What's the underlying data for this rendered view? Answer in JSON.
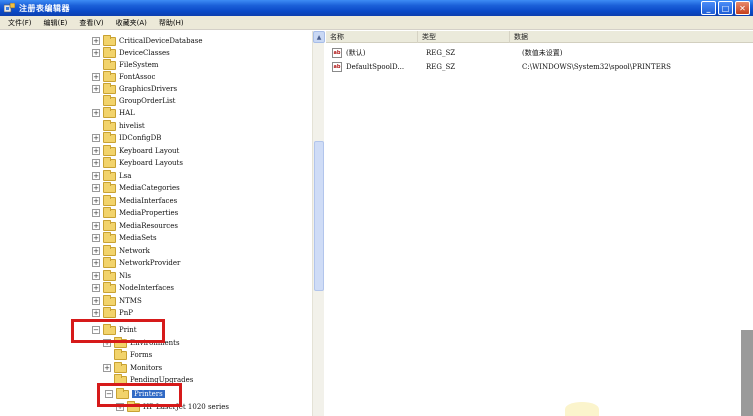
{
  "window": {
    "title": "注册表编辑器",
    "buttons": {
      "minimize": "_",
      "maximize": "□",
      "close": "✕"
    }
  },
  "menu": [
    "文件(F)",
    "编辑(E)",
    "查看(V)",
    "收藏夹(A)",
    "帮助(H)"
  ],
  "tree": {
    "items": [
      {
        "label": "CriticalDeviceDatabase",
        "expander": "+"
      },
      {
        "label": "DeviceClasses",
        "expander": "+"
      },
      {
        "label": "FileSystem",
        "expander": ""
      },
      {
        "label": "FontAssoc",
        "expander": "+"
      },
      {
        "label": "GraphicsDrivers",
        "expander": "+"
      },
      {
        "label": "GroupOrderList",
        "expander": ""
      },
      {
        "label": "HAL",
        "expander": "+"
      },
      {
        "label": "hivelist",
        "expander": ""
      },
      {
        "label": "IDConfigDB",
        "expander": "+"
      },
      {
        "label": "Keyboard Layout",
        "expander": "+"
      },
      {
        "label": "Keyboard Layouts",
        "expander": "+"
      },
      {
        "label": "Lsa",
        "expander": "+"
      },
      {
        "label": "MediaCategories",
        "expander": "+"
      },
      {
        "label": "MediaInterfaces",
        "expander": "+"
      },
      {
        "label": "MediaProperties",
        "expander": "+"
      },
      {
        "label": "MediaResources",
        "expander": "+"
      },
      {
        "label": "MediaSets",
        "expander": "+"
      },
      {
        "label": "Network",
        "expander": "+"
      },
      {
        "label": "NetworkProvider",
        "expander": "+"
      },
      {
        "label": "Nls",
        "expander": "+"
      },
      {
        "label": "NodeInterfaces",
        "expander": "+"
      },
      {
        "label": "NTMS",
        "expander": "+"
      },
      {
        "label": "PnP",
        "expander": "+"
      },
      {
        "label": "Print",
        "expander": "−"
      },
      {
        "label": "Environments",
        "expander": "+"
      },
      {
        "label": "Forms",
        "expander": ""
      },
      {
        "label": "Monitors",
        "expander": "+"
      },
      {
        "label": "PendingUpgrades",
        "expander": ""
      },
      {
        "label": "Printers",
        "expander": "−",
        "selected": true
      },
      {
        "label": "HP LaserJet 1020 series",
        "expander": "+"
      }
    ]
  },
  "list": {
    "columns": {
      "name": "名称",
      "type": "类型",
      "data": "数据"
    },
    "rows": [
      {
        "name": "(默认)",
        "type": "REG_SZ",
        "data": "(数值未设置)"
      },
      {
        "name": "DefaultSpoolD...",
        "type": "REG_SZ",
        "data": "C:\\WINDOWS\\System32\\spool\\PRINTERS"
      }
    ],
    "icon_label": "ab"
  },
  "colors": {
    "titlebar": "#0a4ac8",
    "selection": "#316ac5",
    "highlight_box": "#d61a1a",
    "folder": "#f2d36b"
  }
}
